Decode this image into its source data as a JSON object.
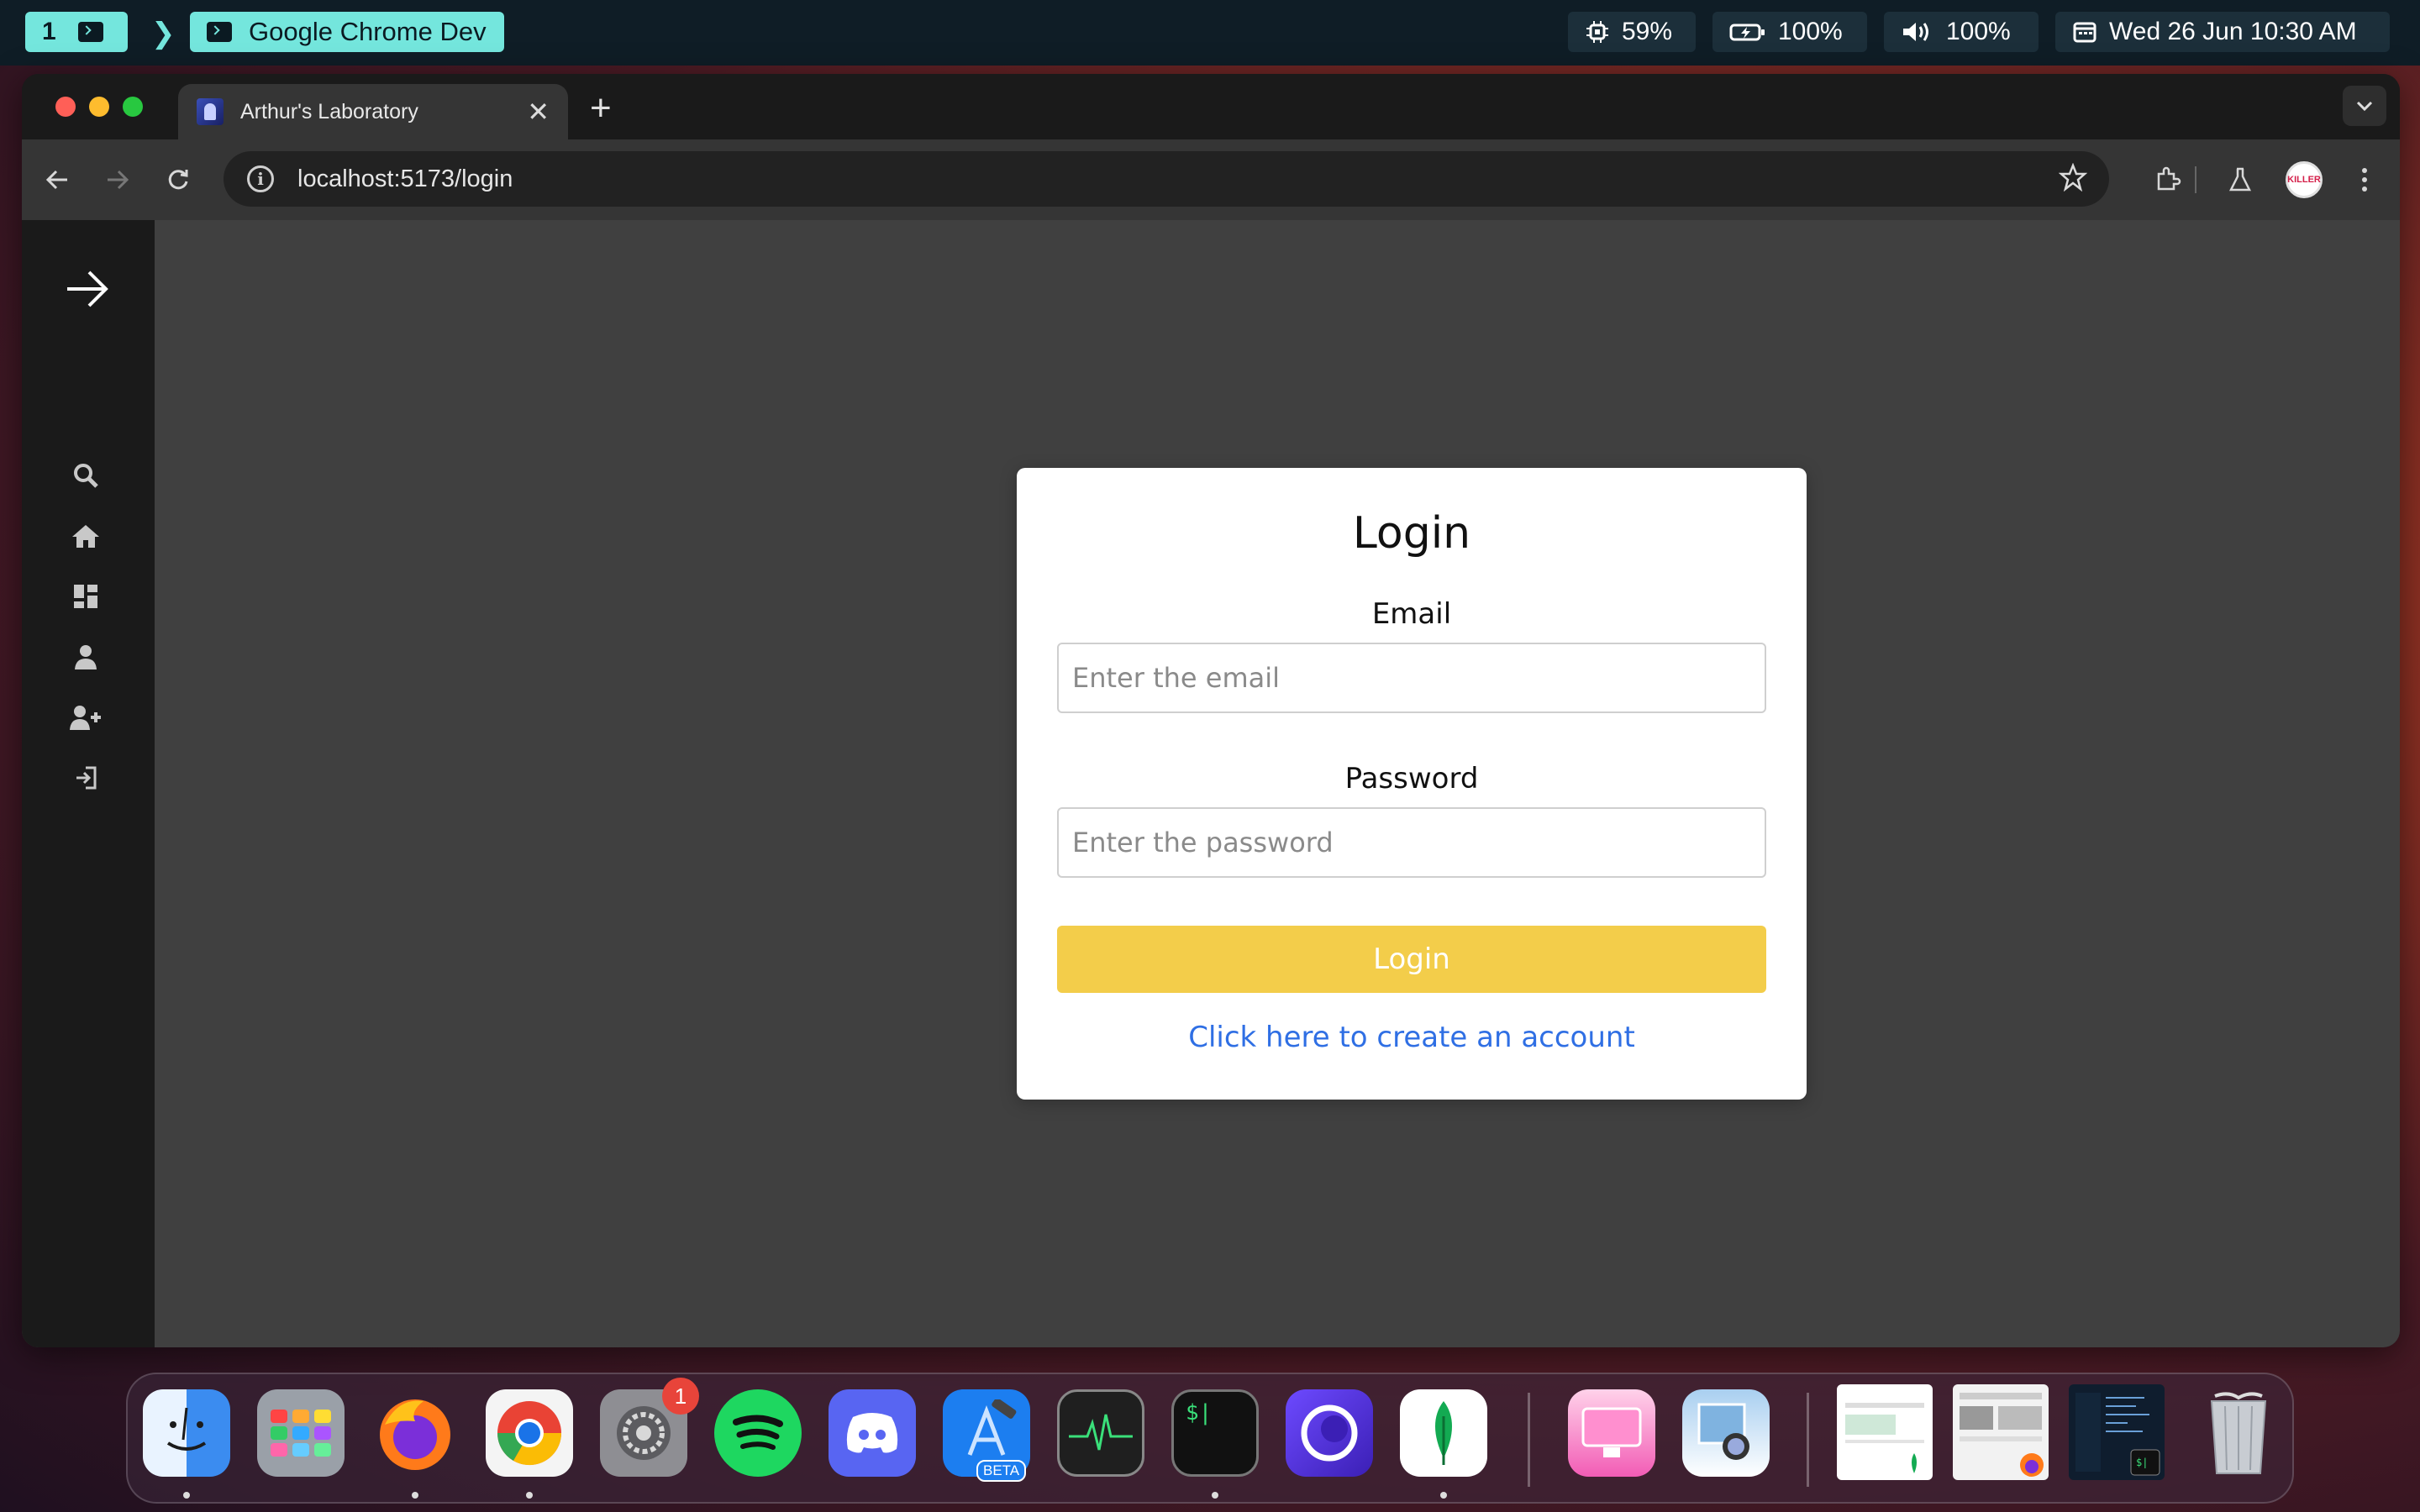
{
  "menubar": {
    "workspace_number": "1",
    "active_app": "Google Chrome Dev",
    "cpu": "59%",
    "battery": "100%",
    "volume": "100%",
    "datetime": "Wed 26 Jun 10:30 AM"
  },
  "browser": {
    "tab_title": "Arthur's Laboratory",
    "url": "localhost:5173/login",
    "avatar_text": "KILLER"
  },
  "sidebar": {
    "items": [
      {
        "icon": "arrow-right-icon"
      },
      {
        "icon": "search-icon"
      },
      {
        "icon": "home-icon"
      },
      {
        "icon": "dashboard-icon"
      },
      {
        "icon": "user-icon"
      },
      {
        "icon": "user-add-icon"
      },
      {
        "icon": "login-icon"
      }
    ]
  },
  "login": {
    "title": "Login",
    "email_label": "Email",
    "email_placeholder": "Enter the email",
    "password_label": "Password",
    "password_placeholder": "Enter the password",
    "submit_label": "Login",
    "create_account_link": "Click here to create an account"
  },
  "dock": {
    "apps": [
      "Finder",
      "Launchpad",
      "Firefox",
      "Chrome Dev",
      "System Settings",
      "Spotify",
      "Discord",
      "Xcode Beta",
      "Activity Monitor",
      "Terminal",
      "Proton VPN",
      "MongoDB Compass",
      "CleanMyMac",
      "Preview"
    ],
    "settings_badge": "1",
    "xcode_badge": "BETA"
  },
  "colors": {
    "accent_yellow": "#f3cd4a",
    "link_blue": "#2f6fe4",
    "menubar_teal": "#74e6dd",
    "page_bg": "#404040",
    "sidebar_bg": "#1a1a1a"
  }
}
